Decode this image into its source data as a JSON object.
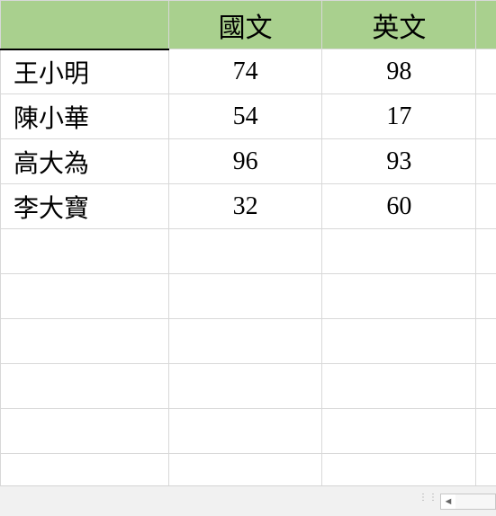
{
  "chart_data": {
    "type": "table",
    "title": "",
    "columns": [
      "",
      "國文",
      "英文"
    ],
    "rows": [
      {
        "name": "王小明",
        "chinese": 74,
        "english": 98
      },
      {
        "name": "陳小華",
        "chinese": 54,
        "english": 17
      },
      {
        "name": "高大為",
        "chinese": 96,
        "english": 93
      },
      {
        "name": "李大寶",
        "chinese": 32,
        "english": 60
      }
    ]
  },
  "headers": {
    "col_a": "",
    "col_b": "國文",
    "col_c": "英文"
  },
  "rows": [
    {
      "name": "王小明",
      "c1": "74",
      "c2": "98"
    },
    {
      "name": "陳小華",
      "c1": "54",
      "c2": "17"
    },
    {
      "name": "高大為",
      "c1": "96",
      "c2": "93"
    },
    {
      "name": "李大寶",
      "c1": "32",
      "c2": "60"
    }
  ]
}
